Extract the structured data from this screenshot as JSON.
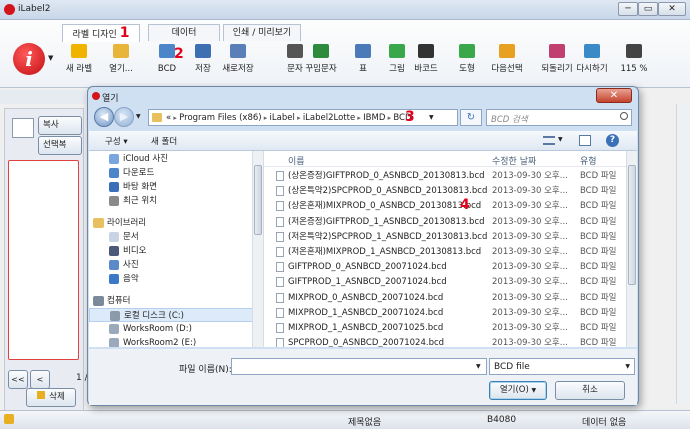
{
  "app": {
    "title": "iLabel2",
    "min": "─",
    "restore": "▭",
    "close": "✕"
  },
  "ribbon": {
    "tabs": [
      {
        "label": "라벨 디자인",
        "num": "1"
      },
      {
        "label": "데이터"
      },
      {
        "label": "인쇄 / 미리보기"
      }
    ],
    "buttons": [
      {
        "label": "새 라벨",
        "color": "#f0b400"
      },
      {
        "label": "열기...",
        "color": "#e8b43a"
      },
      {
        "label": "BCD",
        "color": "#4a86c8"
      },
      {
        "label": "저장",
        "color": "#3d6fb3"
      },
      {
        "label": "새로저장",
        "color": "#5a7fb8"
      },
      {
        "label": "문자",
        "color": "#555555"
      },
      {
        "label": "꾸밈문자",
        "color": "#2e8b3d"
      },
      {
        "label": "표",
        "color": "#4a7ab8"
      },
      {
        "label": "그림",
        "color": "#3aa84a"
      },
      {
        "label": "바코드",
        "color": "#333333"
      },
      {
        "label": "도형",
        "color": "#3aa84a"
      },
      {
        "label": "다음선택",
        "color": "#e8a020"
      },
      {
        "label": "되돌리기",
        "color": "#c04070"
      },
      {
        "label": "다시하기",
        "color": "#3a8ac8"
      },
      {
        "label": "115 %",
        "color": "#444444"
      }
    ],
    "num2": "2"
  },
  "left": {
    "btn1": "복사",
    "btn2": "선택복",
    "delete": "삭제",
    "page": "1 /"
  },
  "status": {
    "title": "제목없음",
    "size": "B4080",
    "data": "데이터 없음"
  },
  "dialog": {
    "title": "열기",
    "path": [
      "«",
      "Program Files (x86)",
      "iLabel",
      "iLabel2Lotte",
      "IBMD",
      "BCD"
    ],
    "num3": "3",
    "search_placeholder": "BCD 검색",
    "toolbar": {
      "organize": "구성 ▾",
      "new_folder": "새 폴더"
    },
    "nav": [
      {
        "type": "item",
        "label": "iCloud 사진",
        "color": "#7aa6e0"
      },
      {
        "type": "item",
        "label": "다운로드",
        "color": "#4a86c8"
      },
      {
        "type": "item",
        "label": "바탕 화면",
        "color": "#3a70b8"
      },
      {
        "type": "item",
        "label": "최근 위치",
        "color": "#8a8a8a"
      },
      {
        "type": "gap"
      },
      {
        "type": "group",
        "label": "라이브러리",
        "color": "#e8c060"
      },
      {
        "type": "item",
        "label": "문서",
        "color": "#c8d4e4"
      },
      {
        "type": "item",
        "label": "비디오",
        "color": "#4a5a78"
      },
      {
        "type": "item",
        "label": "사진",
        "color": "#5a8ac8"
      },
      {
        "type": "item",
        "label": "음악",
        "color": "#3a78c8"
      },
      {
        "type": "gap"
      },
      {
        "type": "group",
        "label": "컴퓨터",
        "color": "#7a8a9a"
      },
      {
        "type": "item",
        "label": "로컬 디스크 (C:)",
        "color": "#8a9aaa",
        "selected": true
      },
      {
        "type": "item",
        "label": "WorksRoom (D:)",
        "color": "#9aaaba"
      },
      {
        "type": "item",
        "label": "WorksRoom2 (E:)",
        "color": "#9aaaba"
      }
    ],
    "columns": {
      "name": "이름",
      "date": "수정한 날짜",
      "type": "유형"
    },
    "files": [
      {
        "name": "(상온증정)GIFTPROD_0_ASNBCD_20130813.bcd",
        "date": "2013-09-30 오후...",
        "type": "BCD 파일"
      },
      {
        "name": "(상온특약2)SPCPROD_0_ASNBCD_20130813.bcd",
        "date": "2013-09-30 오후...",
        "type": "BCD 파일"
      },
      {
        "name": "(상온혼재)MIXPROD_0_ASNBCD_20130813.bcd",
        "date": "2013-09-30 오후...",
        "type": "BCD 파일"
      },
      {
        "name": "(저온증정)GIFTPROD_1_ASNBCD_20130813.bcd",
        "date": "2013-09-30 오후...",
        "type": "BCD 파일"
      },
      {
        "name": "(저온특약2)SPCPROD_1_ASNBCD_20130813.bcd",
        "date": "2013-09-30 오후...",
        "type": "BCD 파일"
      },
      {
        "name": "(저온혼재)MIXPROD_1_ASNBCD_20130813.bcd",
        "date": "2013-09-30 오후...",
        "type": "BCD 파일"
      },
      {
        "name": "GIFTPROD_0_ASNBCD_20071024.bcd",
        "date": "2013-09-30 오후...",
        "type": "BCD 파일"
      },
      {
        "name": "GIFTPROD_1_ASNBCD_20071024.bcd",
        "date": "2013-09-30 오후...",
        "type": "BCD 파일"
      },
      {
        "name": "MIXPROD_0_ASNBCD_20071024.bcd",
        "date": "2013-09-30 오후...",
        "type": "BCD 파일"
      },
      {
        "name": "MIXPROD_1_ASNBCD_20071024.bcd",
        "date": "2013-09-30 오후...",
        "type": "BCD 파일"
      },
      {
        "name": "MIXPROD_1_ASNBCD_20071025.bcd",
        "date": "2013-09-30 오후...",
        "type": "BCD 파일"
      },
      {
        "name": "SPCPROD_0_ASNBCD_20071024.bcd",
        "date": "2013-09-30 오후...",
        "type": "BCD 파일"
      }
    ],
    "num4": "4",
    "filename_label": "파일 이름(N):",
    "filename_value": "",
    "filetype": "BCD file",
    "open": "열기(O)",
    "cancel": "취소"
  }
}
